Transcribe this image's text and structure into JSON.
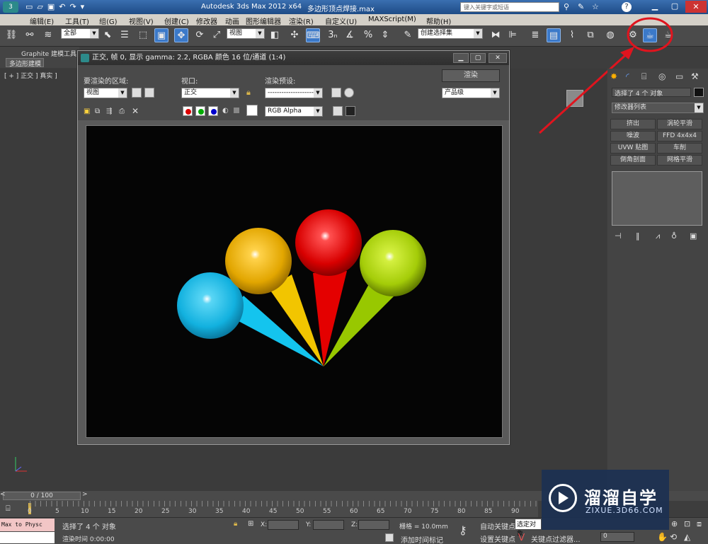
{
  "app": {
    "title": "Autodesk 3ds Max  2012 x64",
    "file": "多边形顶点焊接.max",
    "search_placeholder": "键入关键字或短语"
  },
  "menu": [
    "编辑(E)",
    "工具(T)",
    "组(G)",
    "视图(V)",
    "创建(C)",
    "修改器",
    "动画",
    "图形编辑器",
    "渲染(R)",
    "自定义(U)",
    "MAXScript(M)",
    "帮助(H)"
  ],
  "toolbar": {
    "selection_filter": "全部",
    "ref_coord": "视图",
    "named_sel": "创建选择集"
  },
  "ribbon": {
    "tab": "Graphite 建模工具",
    "sub": "多边形建模"
  },
  "viewport": {
    "label": "[ + ] 正交 ] 真实 ]"
  },
  "render_window": {
    "title": "正交, 帧 0, 显示 gamma: 2.2, RGBA 颜色 16 位/通道 (1:4)",
    "area_label": "要渲染的区域:",
    "area_value": "视图",
    "viewport_label": "视口:",
    "viewport_value": "正交",
    "preset_label": "渲染预设:",
    "preset_value": "--------------------",
    "render_btn": "渲染",
    "quality_value": "产品级",
    "channel_value": "RGB Alpha",
    "spheres": [
      {
        "color": "#1ab7e6",
        "cone": "#12c6f0"
      },
      {
        "color": "#e8b40a",
        "cone": "#f0c400"
      },
      {
        "color": "#e00c0c",
        "cone": "#e60000"
      },
      {
        "color": "#a8d20a",
        "cone": "#9ccc00"
      }
    ]
  },
  "cmdpanel": {
    "selected": "选择了 4 个 对象",
    "modifier_list": "修改器列表",
    "buttons": [
      "挤出",
      "涡轮平滑",
      "噪波",
      "FFD 4x4x4",
      "UVW 贴图",
      "车削",
      "倒角剖面",
      "网格平滑"
    ]
  },
  "timeline": {
    "frame": "0 / 100",
    "ticks": [
      "0",
      "5",
      "10",
      "15",
      "20",
      "25",
      "30",
      "35",
      "40",
      "45",
      "50",
      "55",
      "60",
      "65",
      "70",
      "75",
      "80",
      "85",
      "90"
    ]
  },
  "status": {
    "left": "Max to Physc",
    "msg": "选择了 4 个 对象",
    "hint": "渲染时间 0:00:00",
    "x": "X:",
    "y": "Y:",
    "z": "Z:",
    "grid": "栅格 = 10.0mm",
    "add_tag": "添加时间标记",
    "auto_key": "自动关键点",
    "set_key": "设置关键点",
    "selected_obj": "选定对象",
    "key_filter": "关键点过滤器...",
    "frame_field": "0"
  },
  "watermark": {
    "brand": "溜溜自学",
    "url": "ZIXUE.3D66.COM"
  },
  "colors": {
    "accent": "#3b79c9",
    "annotation": "#e0141e"
  }
}
